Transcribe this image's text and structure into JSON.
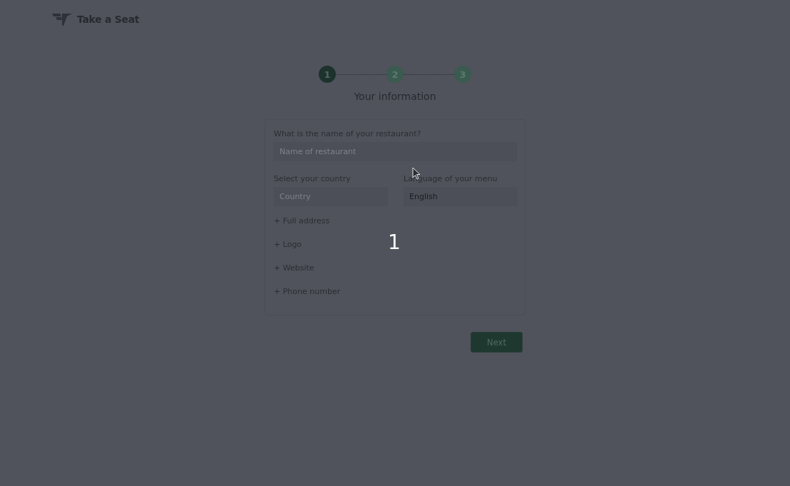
{
  "brand": {
    "name": "Take a Seat"
  },
  "steps": [
    {
      "label": "1",
      "selected": true
    },
    {
      "label": "2",
      "selected": false
    },
    {
      "label": "3",
      "selected": false
    }
  ],
  "title": "Your information",
  "form": {
    "name_field": {
      "label": "What is the name of your restaurant?",
      "placeholder": "Name of restaurant"
    },
    "country_field": {
      "label": "Select your country",
      "placeholder": "Country"
    },
    "language_field": {
      "label": "Language of your menu",
      "value": "English"
    },
    "optional_links": [
      "+ Full address",
      "+ Logo",
      "+ Website",
      "+ Phone number"
    ]
  },
  "next_button": "Next",
  "countdown": "1"
}
